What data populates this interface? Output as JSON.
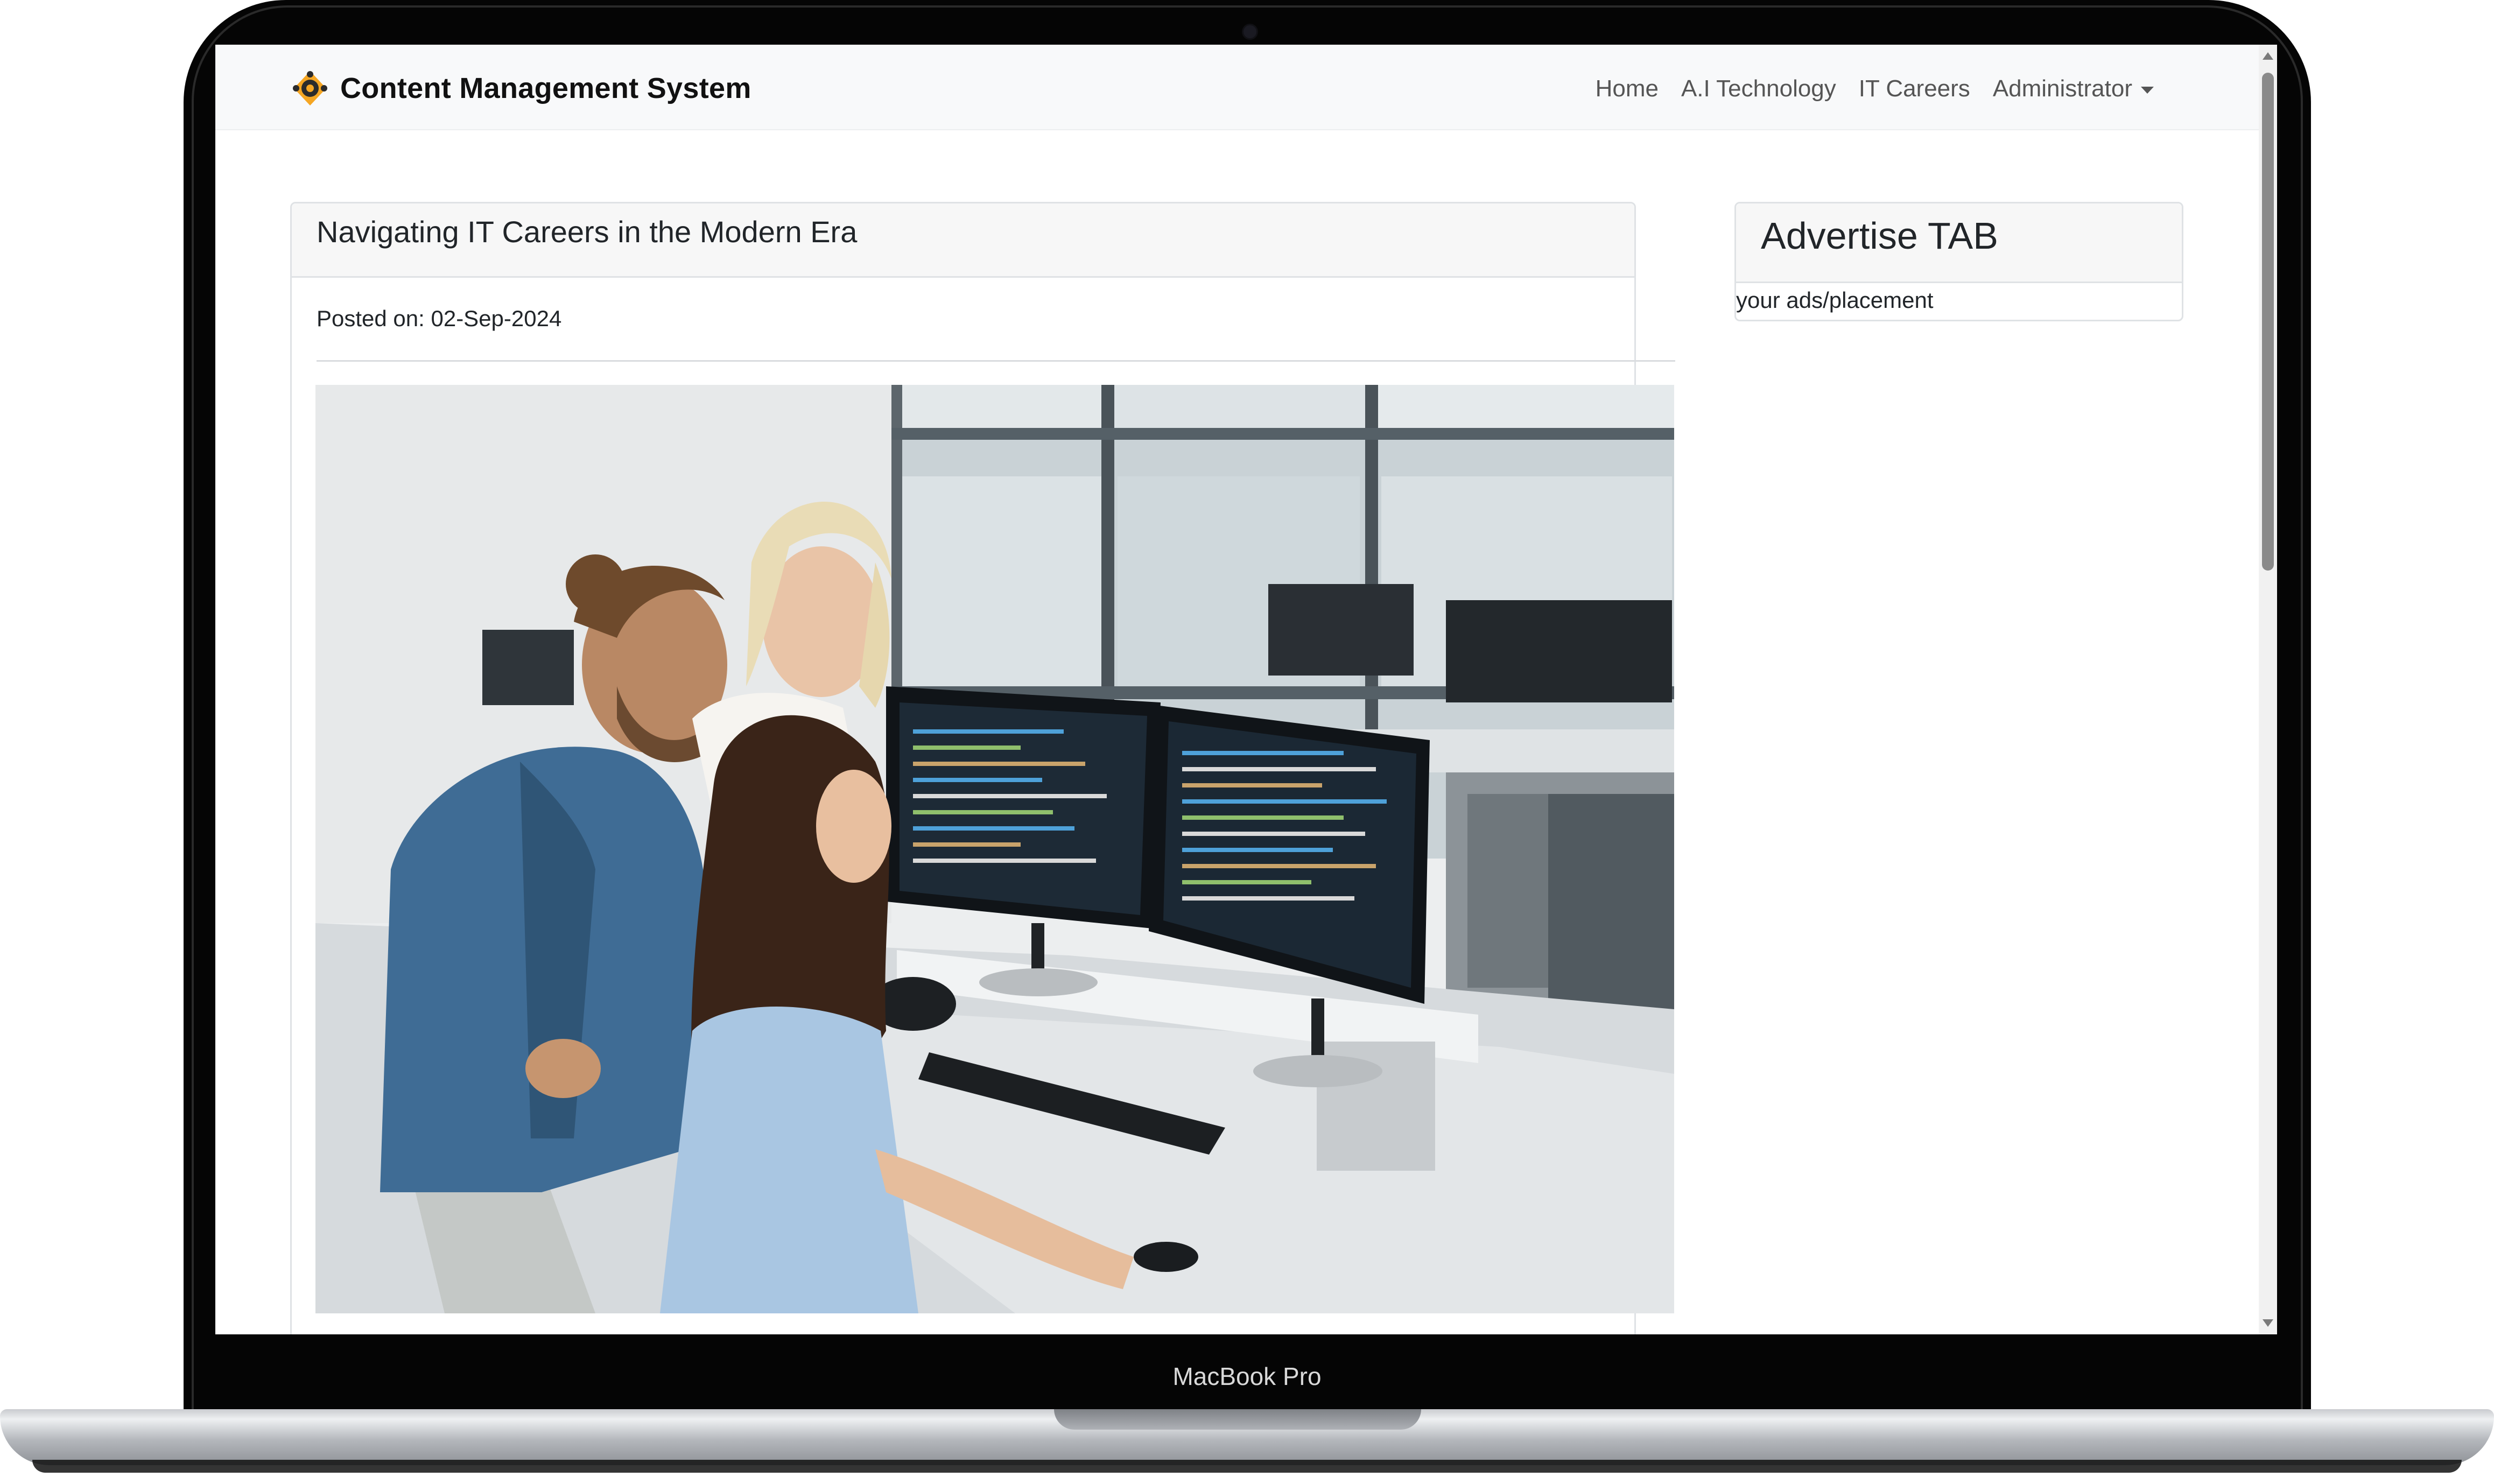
{
  "device": {
    "label": "MacBook Pro"
  },
  "navbar": {
    "brand": "Content Management System",
    "links": [
      {
        "label": "Home"
      },
      {
        "label": "A.I Technology"
      },
      {
        "label": "IT Careers"
      },
      {
        "label": "Administrator"
      }
    ]
  },
  "article": {
    "title": "Navigating IT Careers in the Modern Era",
    "posted": "Posted on: 02-Sep-2024",
    "image_alt": "Three colleagues working together at dual-monitor computers in a bright office"
  },
  "sidebar": {
    "ad_title": "Advertise TAB",
    "ad_body": "your ads/placement"
  },
  "colors": {
    "navbar_bg": "#f8f9fa",
    "card_header_bg": "#f7f7f7",
    "logo_orange": "#f5a623",
    "logo_dark": "#2b2b2b"
  }
}
